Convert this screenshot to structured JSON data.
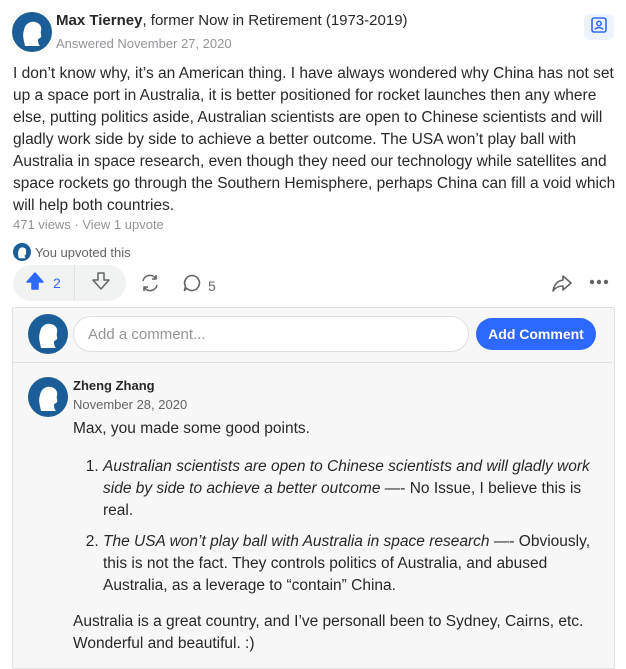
{
  "answer": {
    "author_name": "Max Tierney",
    "author_credential": ", former Now in Retirement (1973-2019)",
    "answered_date": "Answered November 27, 2020",
    "text": "I don’t know why, it’s an American thing. I have always wondered why China has not set up a space port in Australia, it is better positioned for rocket launches then any where else, putting politics aside, Australian scientists are open to Chinese scientists and will gladly work side by side to achieve a better outcome. The USA won’t play ball with Australia in space research, even though they need our technology while satellites and space rockets go through the Southern Hemisphere, perhaps China can fill a void which will help both countries.",
    "stats": "471 views · View 1 upvote",
    "upvoted_note": "You upvoted this"
  },
  "actions": {
    "upvote_count": "2",
    "comment_count": "5",
    "icons": [
      "upvote-arrow",
      "downvote-arrow",
      "share-cycle",
      "comment-bubble",
      "share-arrow",
      "more-dots"
    ]
  },
  "comment_box": {
    "placeholder": "Add a comment...",
    "button_label": "Add Comment"
  },
  "comment": {
    "author": "Zheng Zhang",
    "date": "November 28, 2020",
    "intro": "Max, you made some good points.",
    "items": [
      {
        "quote": "Australian scientists are open to Chinese scientists and will gladly work side by side to achieve a better outcome",
        "reply": " —- No Issue, I believe this is real."
      },
      {
        "quote": "The USA won’t play ball with Australia in space research",
        "reply": " —- Obviously, this is not the fact. They controls politics of Australia, and abused Australia, as a leverage to “contain” China."
      }
    ],
    "closing": "Australia is a great country, and I’ve personall been to Sydney, Cairns, etc. Wonderful and beautiful. :)"
  },
  "colors": {
    "accent": "#2e69ff",
    "avatar": "#1b5d96",
    "muted": "#939598"
  }
}
